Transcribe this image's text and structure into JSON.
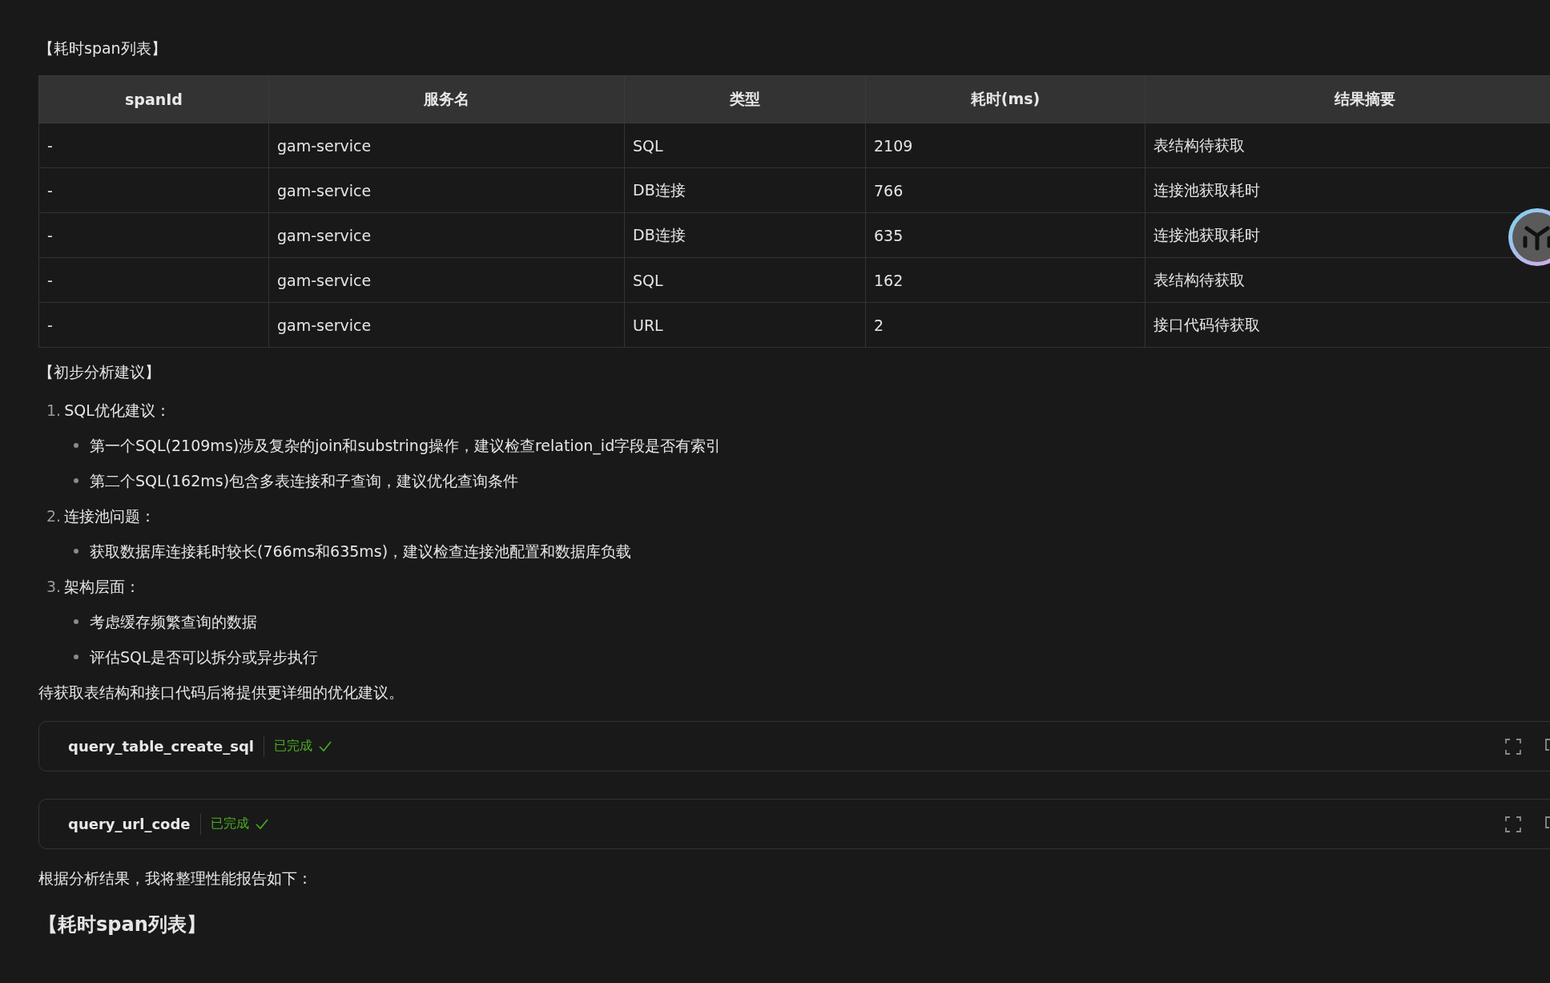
{
  "section_title": "【耗时span列表】",
  "table": {
    "columns": [
      "spanId",
      "服务名",
      "类型",
      "耗时(ms)",
      "结果摘要"
    ],
    "rows": [
      [
        "-",
        "gam-service",
        "SQL",
        "2109",
        "表结构待获取"
      ],
      [
        "-",
        "gam-service",
        "DB连接",
        "766",
        "连接池获取耗时"
      ],
      [
        "-",
        "gam-service",
        "DB连接",
        "635",
        "连接池获取耗时"
      ],
      [
        "-",
        "gam-service",
        "SQL",
        "162",
        "表结构待获取"
      ],
      [
        "-",
        "gam-service",
        "URL",
        "2",
        "接口代码待获取"
      ]
    ]
  },
  "analysis_title": "【初步分析建议】",
  "analysis": [
    {
      "number": "1.",
      "text": "SQL优化建议：",
      "children": [
        "第一个SQL(2109ms)涉及复杂的join和substring操作，建议检查relation_id字段是否有索引",
        "第二个SQL(162ms)包含多表连接和子查询，建议优化查询条件"
      ]
    },
    {
      "number": "2.",
      "text": "连接池问题：",
      "children": [
        "获取数据库连接耗时较长(766ms和635ms)，建议检查连接池配置和数据库负载"
      ]
    },
    {
      "number": "3.",
      "text": "架构层面：",
      "children": [
        "考虑缓存频繁查询的数据",
        "评估SQL是否可以拆分或异步执行"
      ]
    }
  ],
  "note": "待获取表结构和接口代码后将提供更详细的优化建议。",
  "tool_calls": [
    {
      "name": "query_table_create_sql",
      "status": "已完成"
    },
    {
      "name": "query_url_code",
      "status": "已完成"
    }
  ],
  "summary": "根据分析结果，我将整理性能报告如下：",
  "heading": "【耗时span列表】"
}
